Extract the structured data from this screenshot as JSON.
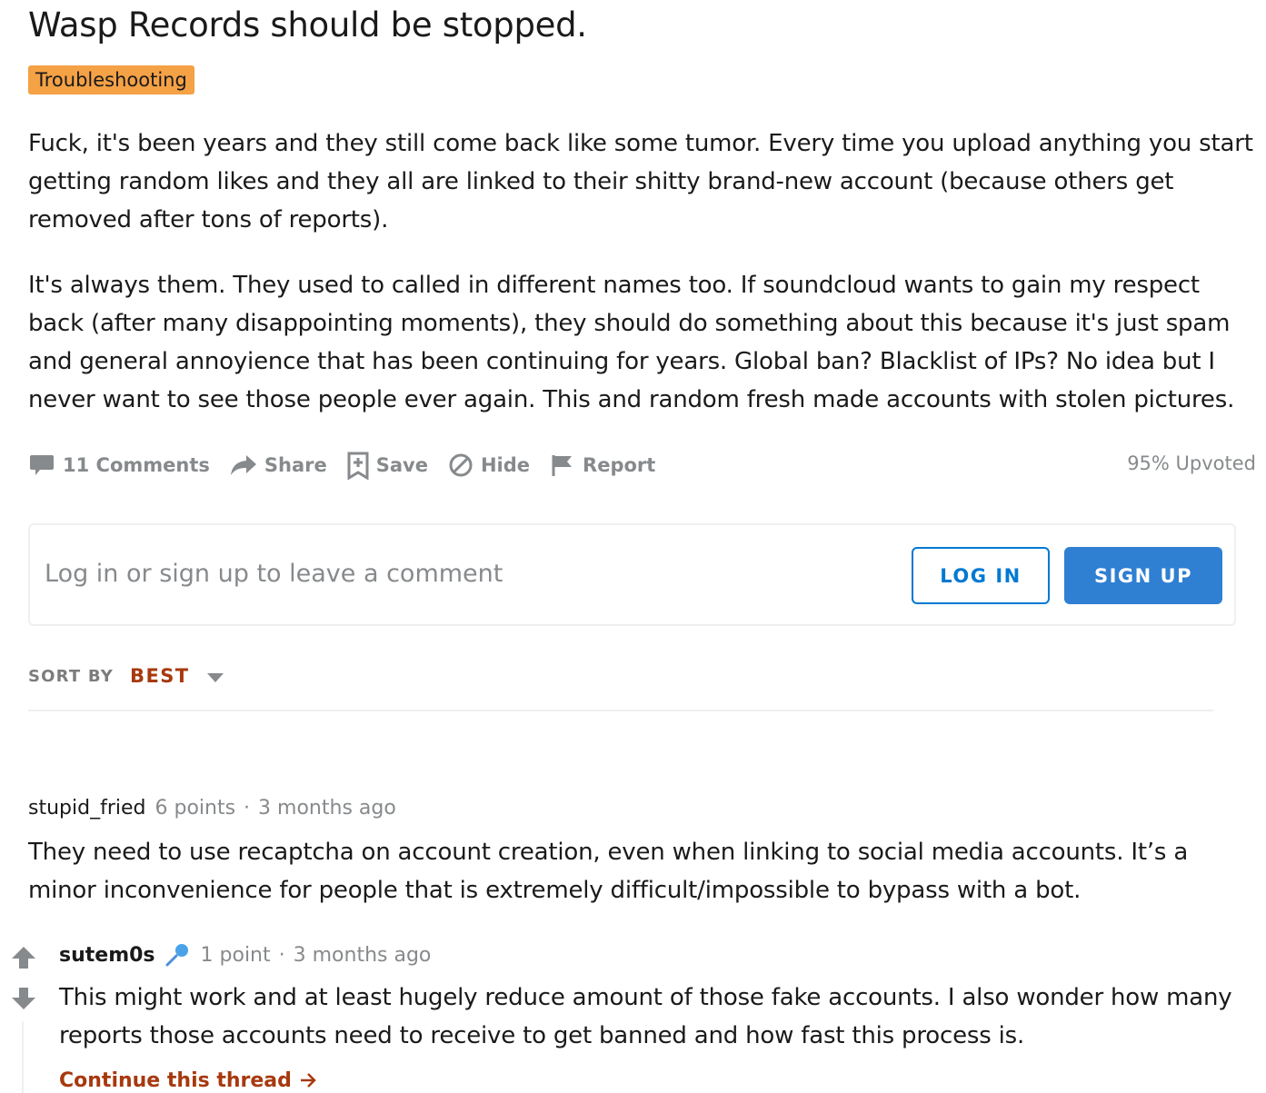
{
  "post": {
    "title": "Wasp Records should be stopped.",
    "flair": "Troubleshooting",
    "paragraphs": [
      "Fuck, it's been years and they still come back like some tumor. Every time you upload anything you start getting random likes and they all are linked to their shitty brand-new account (because others get removed after tons of reports).",
      "It's always them. They used to called in different names too. If soundcloud wants to gain my respect back (after many disappointing moments), they should do something about this because it's just spam and general annoyience that has been continuing for years. Global ban? Blacklist of IPs? No idea but I never want to see those people ever again. This and random fresh made accounts with stolen pictures."
    ],
    "actions": {
      "comments": "11 Comments",
      "share": "Share",
      "save": "Save",
      "hide": "Hide",
      "report": "Report"
    },
    "upvoted": "95% Upvoted"
  },
  "comment_box": {
    "prompt": "Log in or sign up to leave a comment",
    "login_label": "LOG IN",
    "signup_label": "SIGN UP"
  },
  "sort": {
    "label": "SORT BY",
    "value": "BEST"
  },
  "comments": [
    {
      "author": "stupid_fried",
      "points": "6 points",
      "separator": "·",
      "time": "3 months ago",
      "text": "They need to use recaptcha on account creation, even when linking to social media accounts. It’s a minor inconvenience for people that is extremely difficult/impossible to bypass with a bot."
    },
    {
      "author": "sutem0s",
      "points": "1 point",
      "separator": "·",
      "time": "3 months ago",
      "text": "This might work and at least hugely reduce amount of those fake accounts. I also wonder how many reports those accounts need to receive to get banned and how fast this process is."
    }
  ],
  "continue_thread": "Continue this thread",
  "colors": {
    "flair_bg": "#f5a145",
    "accent_blue": "#0079d3",
    "sort_red": "#a7390f",
    "muted": "#878a8c"
  },
  "icons": [
    "comment-icon",
    "share-icon",
    "save-icon",
    "hide-icon",
    "report-icon",
    "caret-down-icon",
    "upvote-icon",
    "downvote-icon",
    "mic-icon",
    "arrow-right-icon"
  ]
}
